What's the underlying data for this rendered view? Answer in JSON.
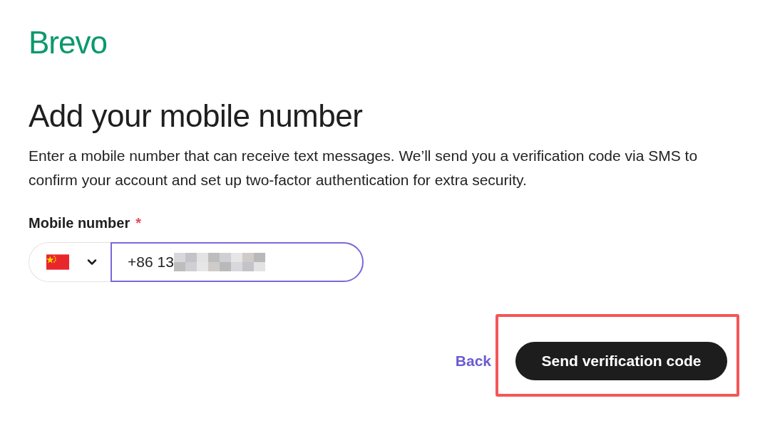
{
  "logo": "Brevo",
  "title": "Add your mobile number",
  "description": "Enter a mobile number that can receive text messages. We’ll send you a verification code via SMS to confirm your account and set up two-factor authentication for extra security.",
  "field": {
    "label": "Mobile number",
    "required_mark": "*",
    "value": "+86 13",
    "focused": true
  },
  "actions": {
    "back": "Back",
    "submit": {
      "label": "Send verification code",
      "highlighted": true
    }
  }
}
